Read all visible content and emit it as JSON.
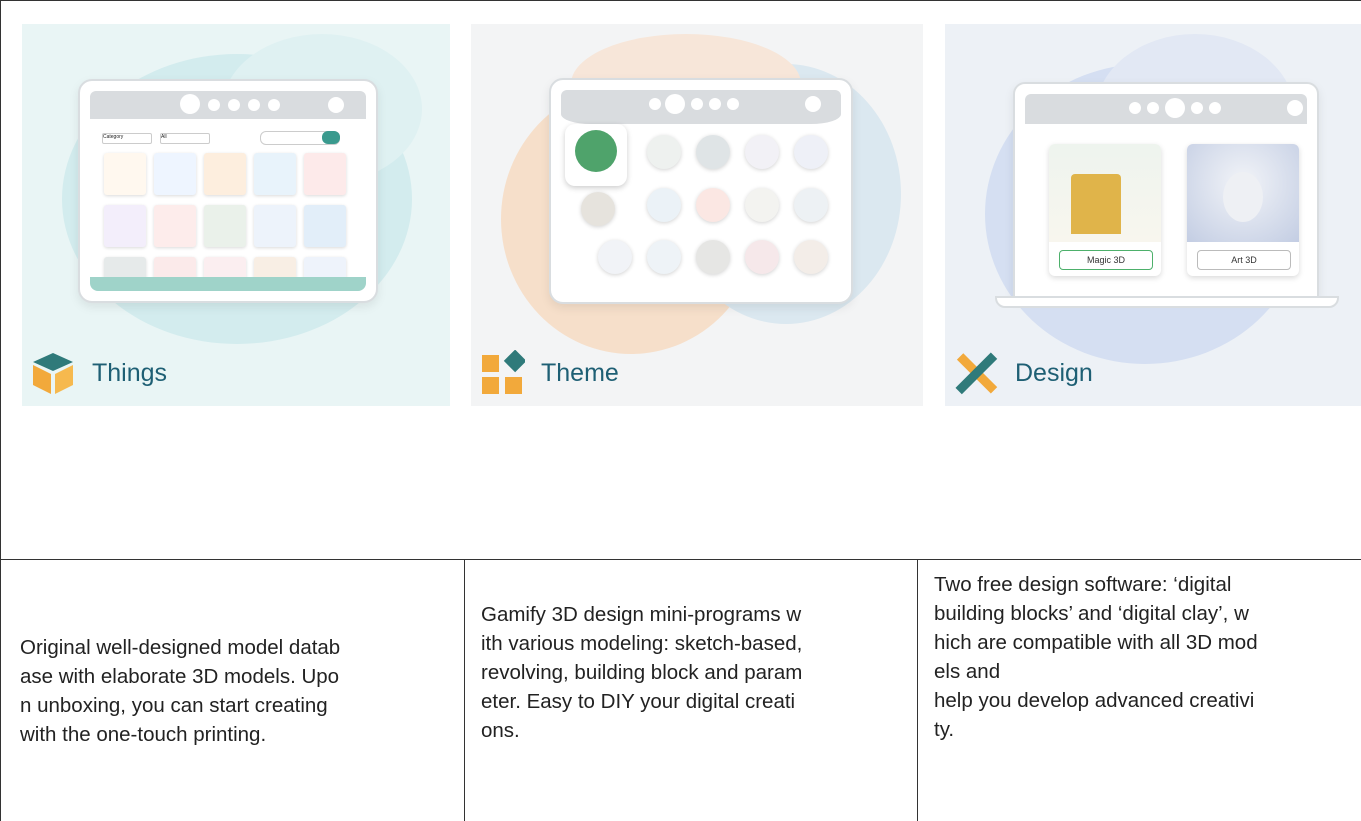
{
  "cards": [
    {
      "title": "Things",
      "icon": "cube-box-icon"
    },
    {
      "title": "Theme",
      "icon": "tiles-grid-icon"
    },
    {
      "title": "Design",
      "icon": "crossed-tools-icon"
    }
  ],
  "mockups": {
    "things": {
      "dropdown_1": "Category",
      "dropdown_2": "All",
      "search_placeholder": ""
    },
    "design": {
      "app_1": "Magic 3D",
      "app_2": "Art 3D"
    }
  },
  "descriptions": [
    "Original well-designed model datab\nase with elaborate 3D models. Upo\nn unboxing, you can start creating\nwith the one-touch printing.",
    "Gamify 3D design mini-programs w\nith various modeling: sketch-based,\nrevolving, building block and param\neter. Easy to DIY your digital creati\nons.",
    "Two free design software: ‘digital\nbuilding blocks’ and ‘digital clay’, w\nhich are compatible with all 3D mod\nels and\nhelp you develop advanced creativi\nty."
  ],
  "colors": {
    "title_teal": "#1e5f74",
    "orange": "#f2a93b",
    "teal_dark": "#2f7a7a"
  }
}
